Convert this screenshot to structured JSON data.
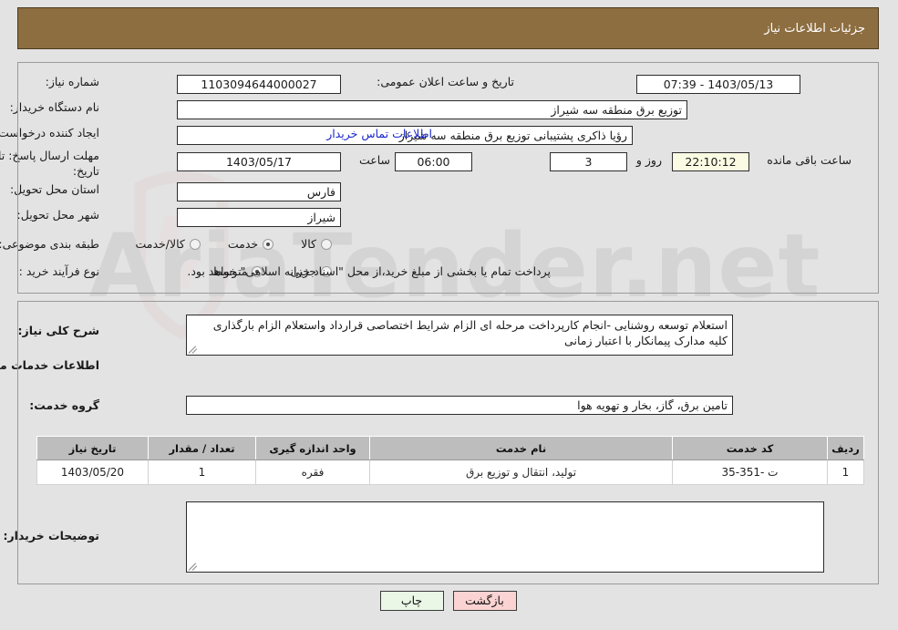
{
  "header": {
    "title": "جزئیات اطلاعات نیاز"
  },
  "form": {
    "need_number_label": "شماره نیاز:",
    "need_number_value": "1103094644000027",
    "announce_label": "تاریخ و ساعت اعلان عمومی:",
    "announce_value": "1403/05/13 - 07:39",
    "buyer_org_label": "نام دستگاه خریدار:",
    "buyer_org_value": "توزیع برق منطقه سه شیراز",
    "creator_label": "ایجاد کننده درخواست:",
    "creator_value": "رؤیا ذاکری پشتیبانی توزیع برق منطقه سه شیراز",
    "contact_link": "اطلاعات تماس خریدار",
    "deadline_label": "مهلت ارسال پاسخ: تا تاریخ:",
    "deadline_date": "1403/05/17",
    "hour_label": "ساعت",
    "deadline_time": "06:00",
    "days_value": "3",
    "days_unit": "روز و",
    "remaining_time": "22:10:12",
    "remaining_suffix": "ساعت باقی مانده",
    "province_label": "استان محل تحویل:",
    "province_value": "فارس",
    "city_label": "شهر محل تحویل:",
    "city_value": "شیراز",
    "category_label": "طبقه بندی موضوعی:",
    "category_options": [
      {
        "label": "کالا",
        "selected": false
      },
      {
        "label": "خدمت",
        "selected": true
      },
      {
        "label": "کالا/خدمت",
        "selected": false
      }
    ],
    "purchase_type_label": "نوع فرآیند خرید :",
    "purchase_options": [
      {
        "label": "جزیی",
        "selected": false
      },
      {
        "label": "متوسط",
        "selected": true
      }
    ],
    "payment_note": "پرداخت تمام یا بخشی از مبلغ خرید،از محل \"اسناد خزانه اسلامی\" خواهد بود."
  },
  "description": {
    "label": "شرح کلی نیاز:",
    "value": "استعلام توسعه روشنایی -انجام کارپرداخت مرحله ای الزام شرایط اختصاصی قرارداد واستعلام الزام بارگذاری کلیه مدارک پیمانکار با اعتبار زمانی"
  },
  "services_section": {
    "heading": "اطلاعات خدمات مورد نیاز",
    "group_label": "گروه خدمت:",
    "group_value": "تامین برق، گاز، بخار و تهویه هوا"
  },
  "table": {
    "columns": [
      "ردیف",
      "کد خدمت",
      "نام خدمت",
      "واحد اندازه گیری",
      "تعداد / مقدار",
      "تاریخ نیاز"
    ],
    "rows": [
      {
        "row_no": "1",
        "service_code": "ت -351-35",
        "service_name": "تولید، انتقال و توزیع برق",
        "unit": "فقره",
        "quantity": "1",
        "need_date": "1403/05/20"
      }
    ]
  },
  "buyer_notes": {
    "label": "توضیحات خریدار:",
    "value": ""
  },
  "buttons": {
    "back": "بازگشت",
    "print": "چاپ"
  },
  "watermark": {
    "text": "AriaTender.net"
  },
  "colors": {
    "header_bar": "#8d6e41",
    "page_bg": "#e3e3e3",
    "link": "#1a27c8",
    "table_header": "#bdbdbd",
    "back_button": "#fbd3d3",
    "print_button": "#eaf7e6",
    "countdown_field": "#fbfbe4"
  }
}
